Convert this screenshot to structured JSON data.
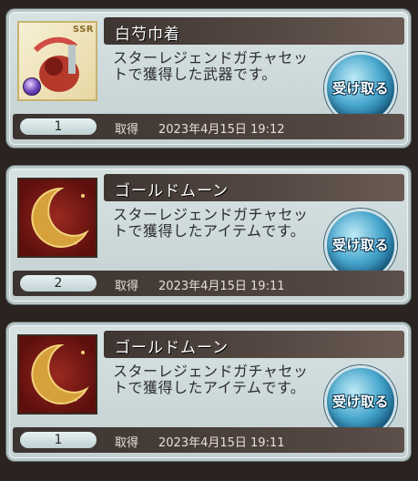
{
  "cards": [
    {
      "title": "白芍巾着",
      "desc": "スターレジェンドガチャセットで獲得した武器です。",
      "qty": "1",
      "acquired_label": "取得",
      "acquired_at": "2023年4月15日 19:12",
      "receive_label": "受け取る",
      "thumb_type": "weapon",
      "badge": "SSR"
    },
    {
      "title": "ゴールドムーン",
      "desc": "スターレジェンドガチャセットで獲得したアイテムです。",
      "qty": "2",
      "acquired_label": "取得",
      "acquired_at": "2023年4月15日 19:11",
      "receive_label": "受け取る",
      "thumb_type": "moon"
    },
    {
      "title": "ゴールドムーン",
      "desc": "スターレジェンドガチャセットで獲得したアイテムです。",
      "qty": "1",
      "acquired_label": "取得",
      "acquired_at": "2023年4月15日 19:11",
      "receive_label": "受け取る",
      "thumb_type": "moon"
    }
  ],
  "colors": {
    "bg": "#2a2320",
    "card": "#d7e2e3",
    "title_bar": "#3e3532",
    "button": "#4aa8cf",
    "text": "#2c2c2c"
  },
  "icons": [
    "weapon-item-icon",
    "gold-moon-icon"
  ]
}
